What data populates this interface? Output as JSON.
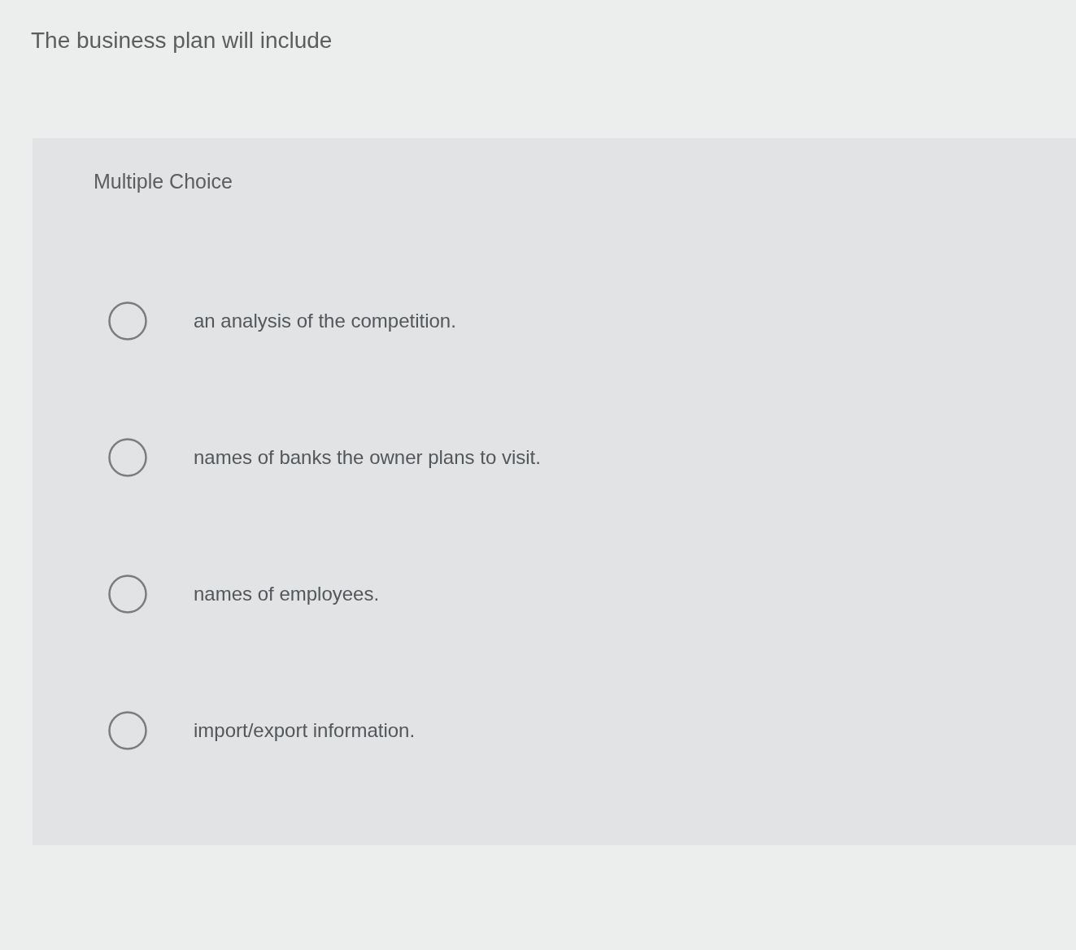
{
  "question": {
    "text": "The business plan will include"
  },
  "panel": {
    "heading": "Multiple Choice",
    "options": [
      {
        "label": "an analysis of the competition.",
        "selected": false
      },
      {
        "label": "names of banks the owner plans to visit.",
        "selected": false
      },
      {
        "label": "names of employees.",
        "selected": false
      },
      {
        "label": "import/export information.",
        "selected": false
      }
    ]
  }
}
